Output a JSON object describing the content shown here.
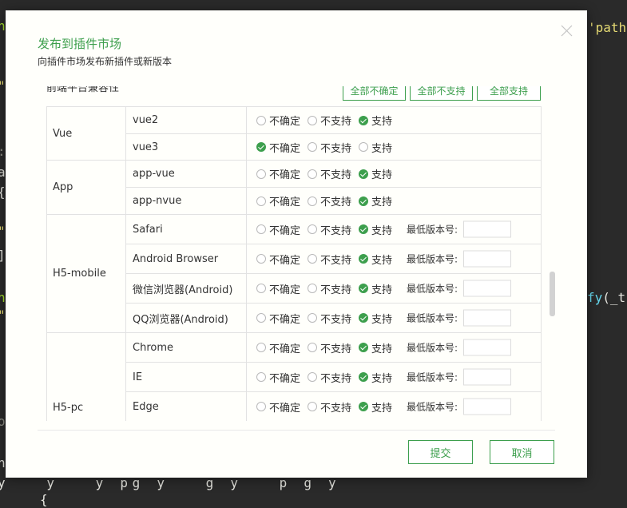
{
  "editor": {
    "left_fragments": [
      "n",
      "\"",
      ":",
      "a",
      "{",
      "\"",
      "]",
      "n",
      "\"",
      "o",
      "n"
    ],
    "right_top": "'path",
    "right_mid_fn": "fy",
    "right_mid_rest": "(_t",
    "bottom_line": "y   y   y pg y   g y   p g y",
    "bottom_brace": "{"
  },
  "dialog": {
    "title": "发布到插件市场",
    "subtitle": "向插件市场发布新插件或新版本",
    "close_icon": "close-icon"
  },
  "compat": {
    "section_title": "前端平台兼容性",
    "bulk_buttons": [
      "全部不确定",
      "全部不支持",
      "全部支持"
    ],
    "options": [
      "不确定",
      "不支持",
      "支持"
    ],
    "min_version_label": "最低版本号:",
    "groups": [
      {
        "name": "Vue",
        "rows": [
          {
            "platform": "vue2",
            "value": "支持"
          },
          {
            "platform": "vue3",
            "value": "不确定"
          }
        ]
      },
      {
        "name": "App",
        "rows": [
          {
            "platform": "app-vue",
            "value": "支持"
          },
          {
            "platform": "app-nvue",
            "value": "支持"
          }
        ]
      },
      {
        "name": "H5-mobile",
        "rows": [
          {
            "platform": "Safari",
            "value": "支持",
            "min_version": ""
          },
          {
            "platform": "Android Browser",
            "value": "支持",
            "min_version": ""
          },
          {
            "platform": "微信浏览器(Android)",
            "value": "支持",
            "min_version": ""
          },
          {
            "platform": "QQ浏览器(Android)",
            "value": "支持",
            "min_version": ""
          }
        ]
      },
      {
        "name": "H5-pc",
        "rows": [
          {
            "platform": "Chrome",
            "value": "支持",
            "min_version": ""
          },
          {
            "platform": "IE",
            "value": "支持",
            "min_version": ""
          },
          {
            "platform": "Edge",
            "value": "支持",
            "min_version": ""
          }
        ]
      }
    ]
  },
  "footer": {
    "submit_label": "提交",
    "cancel_label": "取消"
  },
  "colors": {
    "accent": "#3d9f4d",
    "dialog_bg": "#fffffb",
    "editor_bg": "#2a2a2a"
  }
}
